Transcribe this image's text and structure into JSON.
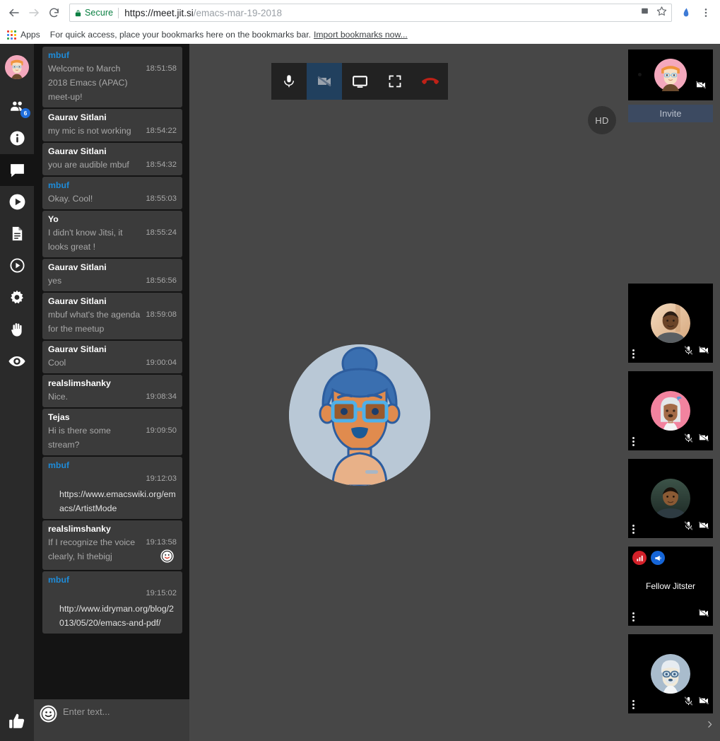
{
  "browser": {
    "back_icon": "back-arrow-icon",
    "forward_icon": "forward-arrow-icon",
    "reload_icon": "reload-icon",
    "security_label": "Secure",
    "url_scheme_host": "https://meet.jit.si",
    "url_path": "/emacs-mar-19-2018",
    "cast_icon": "cast-icon",
    "star_icon": "bookmark-star-icon",
    "extension_icon": "extension-icon",
    "menu_icon": "chrome-menu-icon",
    "apps_label": "Apps",
    "bookmarks_hint": "For quick access, place your bookmarks here on the bookmarks bar.",
    "import_bookmarks": "Import bookmarks now...",
    "secure_color": "#0b8043"
  },
  "left_toolbar": {
    "items": [
      {
        "name": "avatar",
        "icon": "user-avatar-icon",
        "label": "",
        "badge": ""
      },
      {
        "name": "participants",
        "icon": "participants-icon",
        "label": "",
        "badge": "6"
      },
      {
        "name": "info",
        "icon": "info-icon",
        "label": "",
        "badge": ""
      },
      {
        "name": "chat",
        "icon": "chat-bubble-icon",
        "label": "",
        "badge": "",
        "active": true
      },
      {
        "name": "share-video",
        "icon": "play-filled-icon",
        "label": "",
        "badge": ""
      },
      {
        "name": "etherpad",
        "icon": "document-icon",
        "label": "",
        "badge": ""
      },
      {
        "name": "record",
        "icon": "record-outline-icon",
        "label": "",
        "badge": ""
      },
      {
        "name": "settings",
        "icon": "gear-icon",
        "label": "",
        "badge": ""
      },
      {
        "name": "raise-hand",
        "icon": "raised-hand-icon",
        "label": "",
        "badge": ""
      },
      {
        "name": "tile-view",
        "icon": "eye-icon",
        "label": "",
        "badge": ""
      }
    ],
    "bottom_item": {
      "name": "feedback",
      "icon": "thumbs-up-icon"
    },
    "badge_color": "#1e6ddb"
  },
  "chat": {
    "messages": [
      {
        "who": "mbuf",
        "self": true,
        "text": "Welcome to March 2018 Emacs (APAC) meet-up!",
        "time": "18:51:58",
        "link": false
      },
      {
        "who": "Gaurav Sitlani",
        "self": false,
        "text": "my mic is not working",
        "time": "18:54:22",
        "link": false
      },
      {
        "who": "Gaurav Sitlani",
        "self": false,
        "text": "you are audible mbuf",
        "time": "18:54:32",
        "link": false
      },
      {
        "who": "mbuf",
        "self": true,
        "text": "Okay. Cool!",
        "time": "18:55:03",
        "link": false
      },
      {
        "who": "Yo",
        "self": false,
        "text": "I didn't know Jitsi, it looks great !",
        "time": "18:55:24",
        "link": false
      },
      {
        "who": "Gaurav Sitlani",
        "self": false,
        "text": "yes",
        "time": "18:56:56",
        "link": false
      },
      {
        "who": "Gaurav Sitlani",
        "self": false,
        "text": "mbuf what's the agenda for the meetup",
        "time": "18:59:08",
        "link": false
      },
      {
        "who": "Gaurav Sitlani",
        "self": false,
        "text": "Cool",
        "time": "19:00:04",
        "link": false
      },
      {
        "who": "realslimshanky",
        "self": false,
        "text": "Nice.",
        "time": "19:08:34",
        "link": false
      },
      {
        "who": "Tejas",
        "self": false,
        "text": "Hi is there some stream?",
        "time": "19:09:50",
        "link": false
      },
      {
        "who": "mbuf",
        "self": true,
        "text": "https://www.emacswiki.org/emacs/ArtistMode",
        "time": "19:12:03",
        "link": true
      },
      {
        "who": "realslimshanky",
        "self": false,
        "text": "If I recognize the voice",
        "text2": "clearly, hi thebigj",
        "emoji": "smiley-face-emoji",
        "time": "19:13:58",
        "link": false
      },
      {
        "who": "mbuf",
        "self": true,
        "text": "http://www.idryman.org/blog/2013/05/20/emacs-and-pdf/",
        "time": "19:15:02",
        "link": true
      }
    ],
    "input_placeholder": "Enter text...",
    "input_value": "",
    "smiley_icon": "smiley-face-icon",
    "self_name_color": "#1e8bd8"
  },
  "toolbar": {
    "buttons": [
      {
        "name": "microphone",
        "icon": "microphone-icon",
        "toggled": false
      },
      {
        "name": "camera",
        "icon": "camera-off-icon",
        "toggled": true
      },
      {
        "name": "share-screen",
        "icon": "monitor-icon",
        "toggled": false
      },
      {
        "name": "fullscreen",
        "icon": "fullscreen-icon",
        "toggled": false
      },
      {
        "name": "hangup",
        "icon": "hangup-phone-icon",
        "toggled": false
      }
    ],
    "toggled_color": "#21405e",
    "hangup_color": "#bf2117"
  },
  "stage": {
    "hd_badge": "HD",
    "large_avatar_icon": "avatar-blue-hair-glasses"
  },
  "filmstrip": {
    "local": {
      "name": "local-video-tile",
      "avatar_icon": "avatar-pink-orange-hair",
      "camera_off_icon": "camera-off-icon"
    },
    "invite_label": "Invite",
    "invite_color": "#3c4a61",
    "tiles": [
      {
        "name": "",
        "avatar_icon": "photo-man-grey-shirt",
        "muted_mic": true,
        "muted_cam": true,
        "badges": []
      },
      {
        "name": "",
        "avatar_icon": "avatar-white-hair-pink-bg",
        "muted_mic": true,
        "muted_cam": true,
        "badges": []
      },
      {
        "name": "",
        "avatar_icon": "photo-man-checkered-shirt",
        "muted_mic": true,
        "muted_cam": true,
        "badges": []
      },
      {
        "name": "Fellow Jitster",
        "avatar_icon": "",
        "muted_mic": false,
        "muted_cam": true,
        "badges": [
          {
            "kind": "connection-quality",
            "icon": "signal-bars-icon",
            "color": "#d32029"
          },
          {
            "kind": "dominant-speaker",
            "icon": "megaphone-icon",
            "color": "#1565d8"
          }
        ]
      },
      {
        "name": "",
        "avatar_icon": "avatar-grey-beard-glasses",
        "muted_mic": true,
        "muted_cam": true,
        "badges": []
      }
    ],
    "toggle_icon": "chevron-right-icon"
  }
}
